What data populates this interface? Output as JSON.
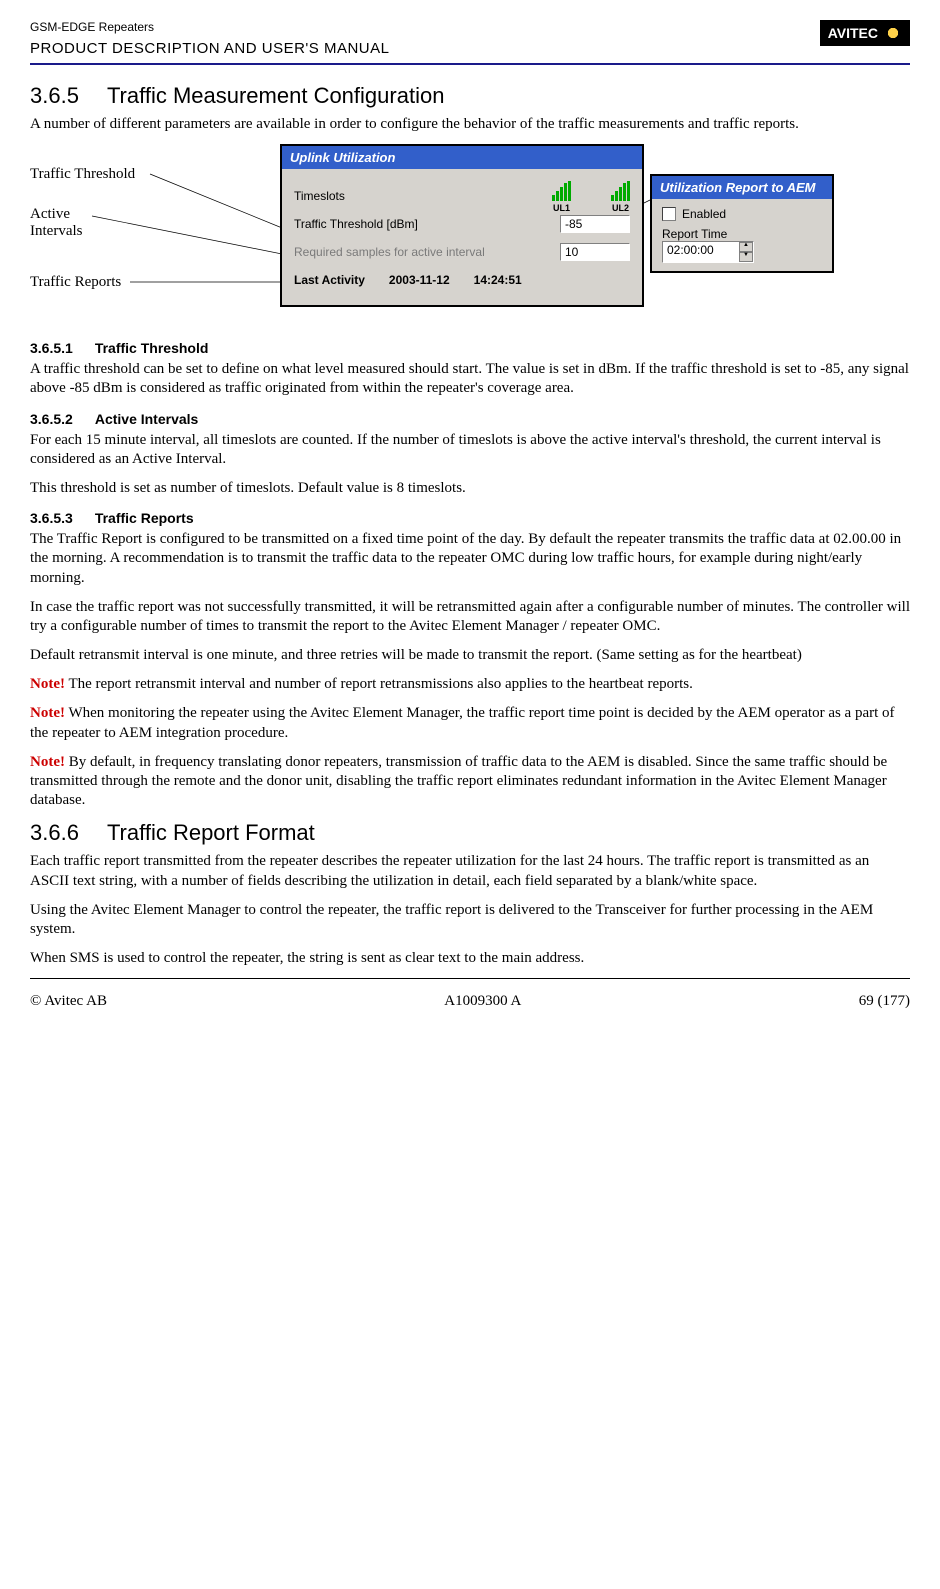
{
  "header": {
    "model": "GSM-EDGE Repeaters",
    "title": "PRODUCT DESCRIPTION AND USER'S MANUAL",
    "logo_text": "AVITEC"
  },
  "s365": {
    "num": "3.6.5",
    "title": "Traffic Measurement Configuration",
    "intro": "A number of different parameters are available in order to configure the behavior of the traffic measurements and traffic reports."
  },
  "callouts": {
    "threshold": "Traffic Threshold",
    "active": "Active Intervals",
    "reports": "Traffic Reports"
  },
  "uplink_panel": {
    "title": "Uplink Utilization",
    "timeslots_label": "Timeslots",
    "ul1": "UL1",
    "ul2": "UL2",
    "threshold_label": "Traffic Threshold [dBm]",
    "threshold_value": "-85",
    "samples_label": "Required samples for active interval",
    "samples_value": "10",
    "last_activity_label": "Last Activity",
    "last_activity_date": "2003-11-12",
    "last_activity_time": "14:24:51"
  },
  "report_panel": {
    "title": "Utilization Report to AEM",
    "enabled_label": "Enabled",
    "report_time_label": "Report Time",
    "report_time_value": "02:00:00"
  },
  "s3651": {
    "num": "3.6.5.1",
    "title": "Traffic Threshold",
    "p1": "A traffic threshold can be set to define on what level measured should start. The value is set in dBm. If the traffic threshold is set to -85, any signal above -85 dBm is considered as traffic originated from within the repeater's coverage area."
  },
  "s3652": {
    "num": "3.6.5.2",
    "title": "Active Intervals",
    "p1": "For each 15 minute interval, all timeslots are counted. If the number of timeslots is above the active interval's threshold, the current interval is considered as an Active Interval.",
    "p2": "This threshold is set as number of timeslots. Default value is 8 timeslots."
  },
  "s3653": {
    "num": "3.6.5.3",
    "title": "Traffic Reports",
    "p1": "The Traffic Report is configured to be transmitted on a fixed time point of the day. By default the repeater transmits the traffic data at 02.00.00 in the morning. A recommendation is to transmit the traffic data to the repeater OMC during low traffic hours, for example during night/early morning.",
    "p2": "In case the traffic report was not successfully transmitted, it will be retransmitted again after a configurable number of minutes. The controller will try a configurable number of times to transmit the report to the Avitec Element Manager / repeater OMC.",
    "p3": "Default retransmit interval is one minute, and three retries will be made to transmit the report. (Same setting as for the heartbeat)",
    "n1a": "Note!",
    "n1b": " The report retransmit interval and number of report retransmissions also applies to the heartbeat reports.",
    "n2a": "Note!",
    "n2b": " When monitoring the repeater using the Avitec Element Manager, the traffic report time point is decided by the AEM operator as a part of the repeater to AEM integration procedure.",
    "n3a": "Note!",
    "n3b": " By default, in frequency translating donor repeaters, transmission of traffic data to the AEM is disabled. Since the same traffic should be transmitted through the remote and the donor unit, disabling the traffic report eliminates redundant information in the Avitec Element Manager database."
  },
  "s366": {
    "num": "3.6.6",
    "title": "Traffic Report Format",
    "p1": "Each traffic report transmitted from the repeater describes the repeater utilization for the last 24 hours. The traffic report is transmitted as an ASCII text string, with a number of fields describing the utilization in detail, each field separated by a blank/white space.",
    "p2": "Using the Avitec Element Manager to control the repeater, the traffic report is delivered to the Transceiver for further processing in the AEM system.",
    "p3": "When SMS is used to control the repeater, the string is sent as clear text to the main address."
  },
  "footer": {
    "left": "© Avitec AB",
    "center": "A1009300 A",
    "right": "69 (177)"
  }
}
